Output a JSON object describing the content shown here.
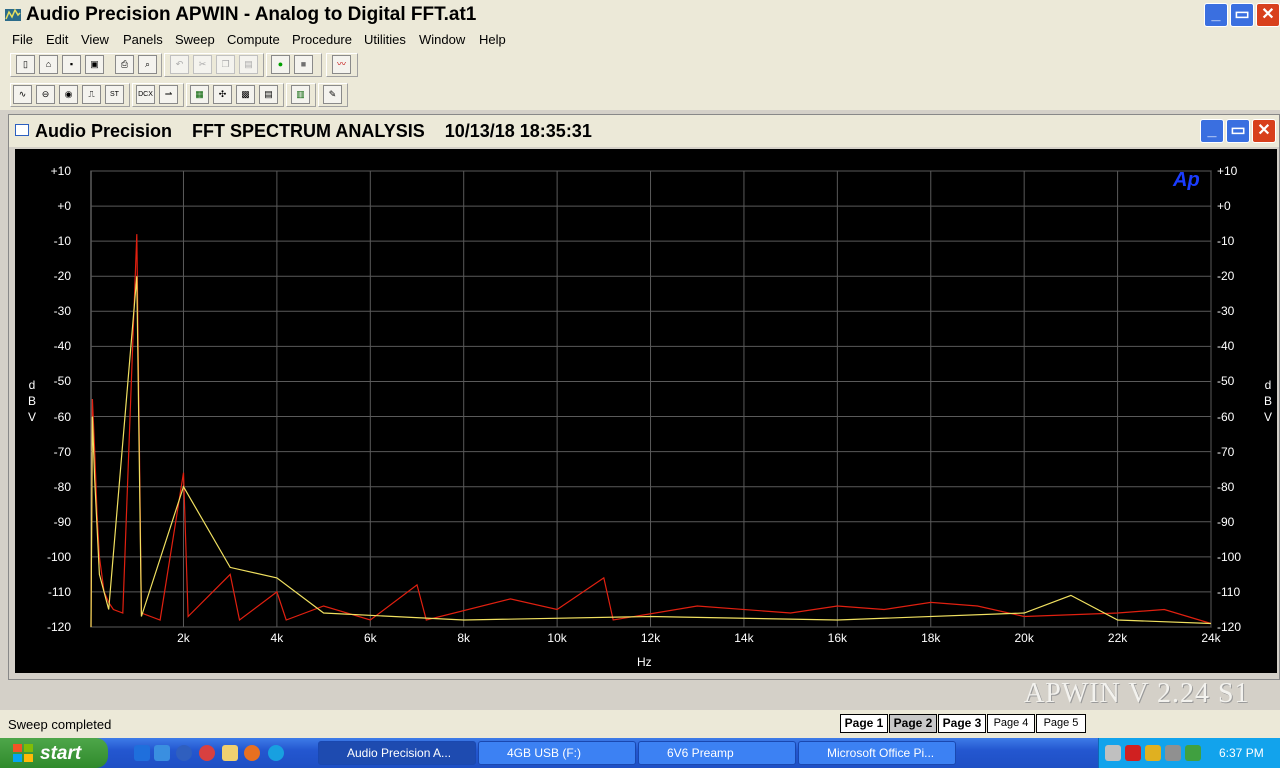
{
  "window": {
    "title": "Audio Precision APWIN - Analog to Digital FFT.at1",
    "minimize": "_",
    "restore": "▭",
    "close": "✕"
  },
  "menu": [
    "File",
    "Edit",
    "View",
    "Panels",
    "Sweep",
    "Compute",
    "Procedure",
    "Utilities",
    "Window",
    "Help"
  ],
  "toolbar1": [
    {
      "name": "new-icon",
      "glyph": "▯",
      "enabled": true
    },
    {
      "name": "open-icon",
      "glyph": "⌂",
      "enabled": true
    },
    {
      "name": "save-icon",
      "glyph": "▪",
      "enabled": true
    },
    {
      "name": "save-all-icon",
      "glyph": "▣",
      "enabled": true
    },
    {
      "name": "print-icon",
      "glyph": "⎙",
      "enabled": true
    },
    {
      "name": "print-preview-icon",
      "glyph": "⌕",
      "enabled": true
    },
    {
      "name": "undo-icon",
      "glyph": "↶",
      "enabled": false
    },
    {
      "name": "cut-icon",
      "glyph": "✂",
      "enabled": false
    },
    {
      "name": "copy-icon",
      "glyph": "❐",
      "enabled": false
    },
    {
      "name": "paste-icon",
      "glyph": "▤",
      "enabled": false
    },
    {
      "name": "go-icon",
      "glyph": "●",
      "enabled": true
    },
    {
      "name": "stop-icon",
      "glyph": "■",
      "enabled": true
    },
    {
      "name": "graph-icon",
      "glyph": "〰",
      "enabled": true
    }
  ],
  "toolbar2": [
    {
      "name": "generator-panel-icon",
      "glyph": "∿"
    },
    {
      "name": "analyzer-panel-icon",
      "glyph": "⊖"
    },
    {
      "name": "level-panel-icon",
      "glyph": "◉"
    },
    {
      "name": "dsp-panel-icon",
      "glyph": "⎍"
    },
    {
      "name": "status-bits-icon",
      "glyph": "ST"
    },
    {
      "name": "dcx-panel-icon",
      "glyph": "DCX"
    },
    {
      "name": "switcher-icon",
      "glyph": "⇀"
    },
    {
      "name": "sweep-panel-icon",
      "glyph": "▦"
    },
    {
      "name": "settling-icon",
      "glyph": "✣"
    },
    {
      "name": "graph-panel-icon",
      "glyph": "▩"
    },
    {
      "name": "data-editor-icon",
      "glyph": "▤"
    },
    {
      "name": "bar-graph-icon",
      "glyph": "▥"
    },
    {
      "name": "macro-editor-icon",
      "glyph": "✎"
    }
  ],
  "graph": {
    "icon": "graph-window-icon",
    "title": "Audio Precision    FFT SPECTRUM ANALYSIS    10/13/18 18:35:31",
    "logo": "Ap",
    "ylabel": "dBV",
    "xlabel": "Hz",
    "yticks": [
      "+10",
      "+0",
      "-10",
      "-20",
      "-30",
      "-40",
      "-50",
      "-60",
      "-70",
      "-80",
      "-90",
      "-100",
      "-110",
      "-120"
    ],
    "xticks": [
      "2k",
      "4k",
      "6k",
      "8k",
      "10k",
      "12k",
      "14k",
      "16k",
      "18k",
      "20k",
      "22k",
      "24k"
    ]
  },
  "chart_data": {
    "type": "line",
    "title": "FFT SPECTRUM ANALYSIS",
    "xlabel": "Hz",
    "ylabel": "dBV",
    "xlim": [
      20,
      24000
    ],
    "ylim": [
      -120,
      10
    ],
    "grid": true,
    "series": [
      {
        "color": "#e02010",
        "points": [
          [
            20,
            -120
          ],
          [
            50,
            -55
          ],
          [
            100,
            -70
          ],
          [
            150,
            -88
          ],
          [
            200,
            -100
          ],
          [
            300,
            -110
          ],
          [
            400,
            -113
          ],
          [
            500,
            -115
          ],
          [
            700,
            -116
          ],
          [
            1000,
            -8
          ],
          [
            1100,
            -116
          ],
          [
            1500,
            -118
          ],
          [
            2000,
            -76
          ],
          [
            2100,
            -117
          ],
          [
            3000,
            -105
          ],
          [
            3200,
            -118
          ],
          [
            4000,
            -110
          ],
          [
            4200,
            -118
          ],
          [
            5000,
            -114
          ],
          [
            6000,
            -118
          ],
          [
            7000,
            -108
          ],
          [
            7200,
            -118
          ],
          [
            9000,
            -112
          ],
          [
            10000,
            -115
          ],
          [
            11000,
            -106
          ],
          [
            11200,
            -118
          ],
          [
            13000,
            -114
          ],
          [
            15000,
            -116
          ],
          [
            16000,
            -114
          ],
          [
            17000,
            -115
          ],
          [
            18000,
            -113
          ],
          [
            19000,
            -114
          ],
          [
            20000,
            -117
          ],
          [
            22000,
            -116
          ],
          [
            23000,
            -115
          ],
          [
            24000,
            -119
          ]
        ]
      },
      {
        "color": "#f0e060",
        "points": [
          [
            20,
            -120
          ],
          [
            50,
            -60
          ],
          [
            100,
            -78
          ],
          [
            200,
            -105
          ],
          [
            400,
            -115
          ],
          [
            1000,
            -20
          ],
          [
            1100,
            -117
          ],
          [
            2000,
            -80
          ],
          [
            3000,
            -103
          ],
          [
            4000,
            -106
          ],
          [
            5000,
            -116
          ],
          [
            8000,
            -118
          ],
          [
            12000,
            -117
          ],
          [
            16000,
            -118
          ],
          [
            20000,
            -116
          ],
          [
            21000,
            -111
          ],
          [
            22000,
            -118
          ],
          [
            24000,
            -119
          ]
        ]
      }
    ]
  },
  "status": {
    "text": "Sweep completed",
    "pages": [
      "Page 1",
      "Page 2",
      "Page 3",
      "Page 4",
      "Page 5"
    ]
  },
  "watermark": "APWIN V 2.24  S1",
  "taskbar": {
    "start": "start",
    "quicklaunch": [
      "ie-icon",
      "outlook-icon",
      "media-player-icon",
      "messenger-icon",
      "folder-icon",
      "firefox-icon",
      "skype-icon"
    ],
    "tasks": [
      "Audio Precision A...",
      "4GB USB (F:)",
      "6V6 Preamp",
      "Microsoft Office Pi..."
    ],
    "time": "6:37 PM"
  },
  "colors": {
    "grid": "#5a5a5a",
    "trace1": "#e02010",
    "trace2": "#f0e060",
    "logo": "#1a3cff"
  }
}
